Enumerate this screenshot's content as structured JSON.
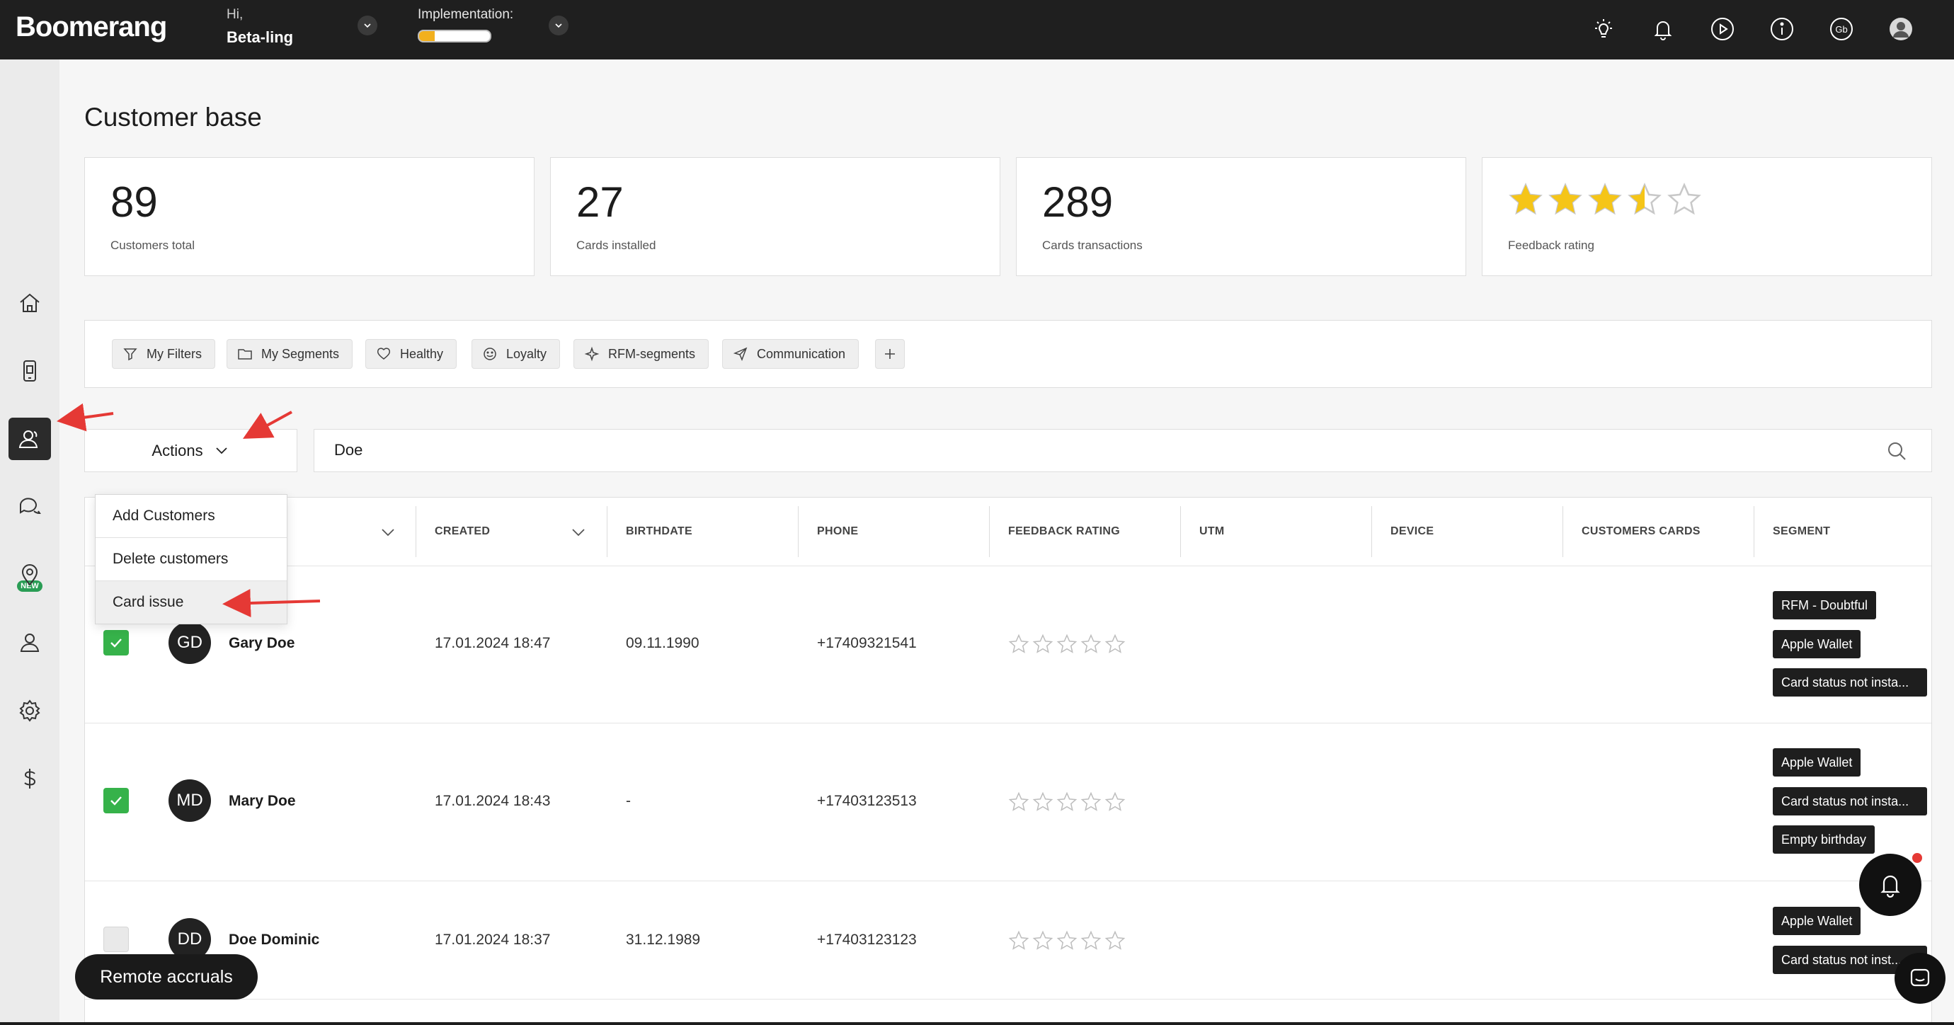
{
  "app": {
    "logo": "Boomerang"
  },
  "header": {
    "greeting": "Hi,",
    "user_name": "Beta-ling",
    "implementation_label": "Implementation:",
    "implementation_progress": 0.22,
    "user_badge": "Gb",
    "icons": [
      "lightbulb-icon",
      "bell-icon",
      "play-icon",
      "info-icon",
      "profile-badge",
      "avatar"
    ]
  },
  "sidebar": {
    "items": [
      "home-icon",
      "mobile-card-icon",
      "customers-icon",
      "chat-icon",
      "location-icon",
      "user-icon",
      "settings-icon",
      "dollar-icon"
    ],
    "active": "customers-icon",
    "new_badge": "NEW"
  },
  "page": {
    "title": "Customer base"
  },
  "stats": [
    {
      "value": "89",
      "label": "Customers total"
    },
    {
      "value": "27",
      "label": "Cards installed"
    },
    {
      "value": "289",
      "label": "Cards transactions"
    },
    {
      "value": "",
      "label": "Feedback rating"
    }
  ],
  "feedback_rating_stars": 3.5,
  "filters": {
    "chips": [
      "My Filters",
      "My Segments",
      "Healthy",
      "Loyalty",
      "RFM-segments",
      "Communication"
    ],
    "add_label": "+"
  },
  "actions": {
    "label": "Actions",
    "menu": [
      "Add Customers",
      "Delete customers",
      "Card issue"
    ],
    "highlighted": "Card issue"
  },
  "search": {
    "value": "Doe",
    "placeholder": ""
  },
  "table": {
    "columns": [
      "CREATED",
      "BIRTHDATE",
      "PHONE",
      "FEEDBACK RATING",
      "UTM",
      "DEVICE",
      "CUSTOMERS CARDS",
      "SEGMENT"
    ],
    "rows": [
      {
        "checked": true,
        "initials": "GD",
        "name": "Gary Doe",
        "created": "17.01.2024 18:47",
        "birthdate": "09.11.1990",
        "phone": "+17409321541",
        "segments": [
          "RFM - Doubtful",
          "Apple Wallet",
          "Card status not insta..."
        ]
      },
      {
        "checked": true,
        "initials": "MD",
        "name": "Mary Doe",
        "created": "17.01.2024 18:43",
        "birthdate": "-",
        "phone": "+17403123513",
        "segments": [
          "Apple Wallet",
          "Card status not insta...",
          "Empty birthday"
        ]
      },
      {
        "checked": false,
        "initials": "DD",
        "name": "Doe Dominic",
        "created": "17.01.2024 18:37",
        "birthdate": "31.12.1989",
        "phone": "+17403123123",
        "segments": [
          "Apple Wallet",
          "Card status not inst..."
        ]
      }
    ]
  },
  "floating": {
    "remote_accruals": "Remote accruals"
  },
  "colors": {
    "topbar": "#1f1f1f",
    "accent_green": "#36b24a",
    "star_gold": "#f5c518",
    "annotation_red": "#e53935",
    "progress": "#f2b01e"
  }
}
